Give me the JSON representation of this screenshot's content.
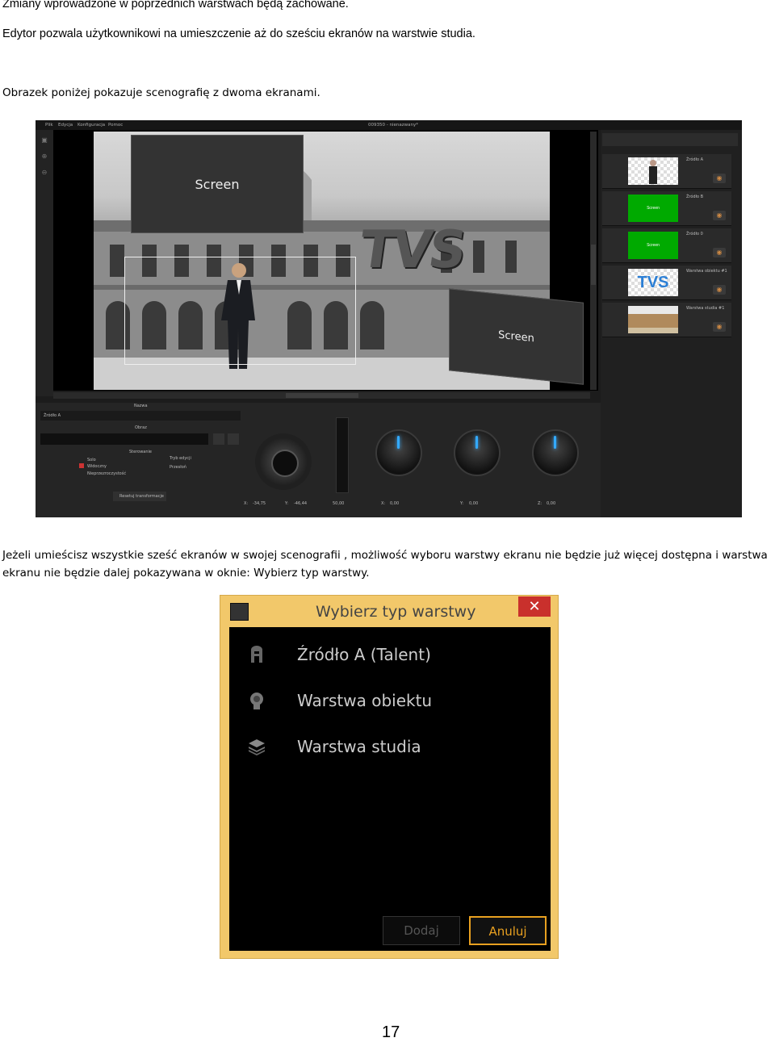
{
  "doc": {
    "line1": "Zmiany wprowadzone w poprzednich warstwach będą zachowane.",
    "line2": "Edytor pozwala użytkownikowi na umieszczenie aż do sześciu ekranów na warstwie studia.",
    "line3": "Obrazek poniżej pokazuje scenografię z dwoma ekranami.",
    "line4": "Jeżeli umieścisz wszystkie sześć ekranów w swojej scenografii , możliwość wyboru warstwy ekranu nie będzie już więcej dostępna i warstwa",
    "line5": "ekranu nie będzie dalej pokazywana w oknie:  Wybierz typ warstwy.",
    "page_number": "17"
  },
  "editor": {
    "menu": [
      "Plik",
      "Edycja",
      "Konfiguracja",
      "Pomoc"
    ],
    "window_title": "009350 - nienazwany*",
    "screen1": "Screen",
    "screen2": "Screen",
    "logo": "TVS",
    "layers": [
      {
        "name": "Źródło A",
        "thumb": ""
      },
      {
        "name": "Źródło B",
        "thumb": "Screen"
      },
      {
        "name": "Źródło 0",
        "thumb": "Screen"
      },
      {
        "name": "Warstwa obiektu #1",
        "thumb": "TVS"
      },
      {
        "name": "Warstwa studia #1",
        "thumb": ""
      }
    ],
    "props": {
      "name_label": "Nazwa",
      "name_value": "Źródło A",
      "image_label": "Obraz",
      "sterowanie": "Sterowanie",
      "cb1": "Solo",
      "cb2": "Widoczny",
      "cb3": "Nieprzezroczystość",
      "mode_label": "Tryb edycji",
      "mode_value": "Przesłoń",
      "reset": "Resetuj transformacje"
    },
    "coords": {
      "x_label": "X:",
      "x_val": "-34,75",
      "y_label": "Y:",
      "y_val": "-46,44",
      "s_val": "50,00",
      "rx_label": "X:",
      "rx_val": "0,00",
      "ry_label": "Y:",
      "ry_val": "0,00",
      "rz_label": "Z:",
      "rz_val": "0,00"
    }
  },
  "dialog": {
    "title": "Wybierz typ warstwy",
    "close": "✕",
    "options": [
      "Źródło A (Talent)",
      "Warstwa obiektu",
      "Warstwa studia"
    ],
    "add": "Dodaj",
    "cancel": "Anuluj",
    "accent": "#f2c86a"
  }
}
